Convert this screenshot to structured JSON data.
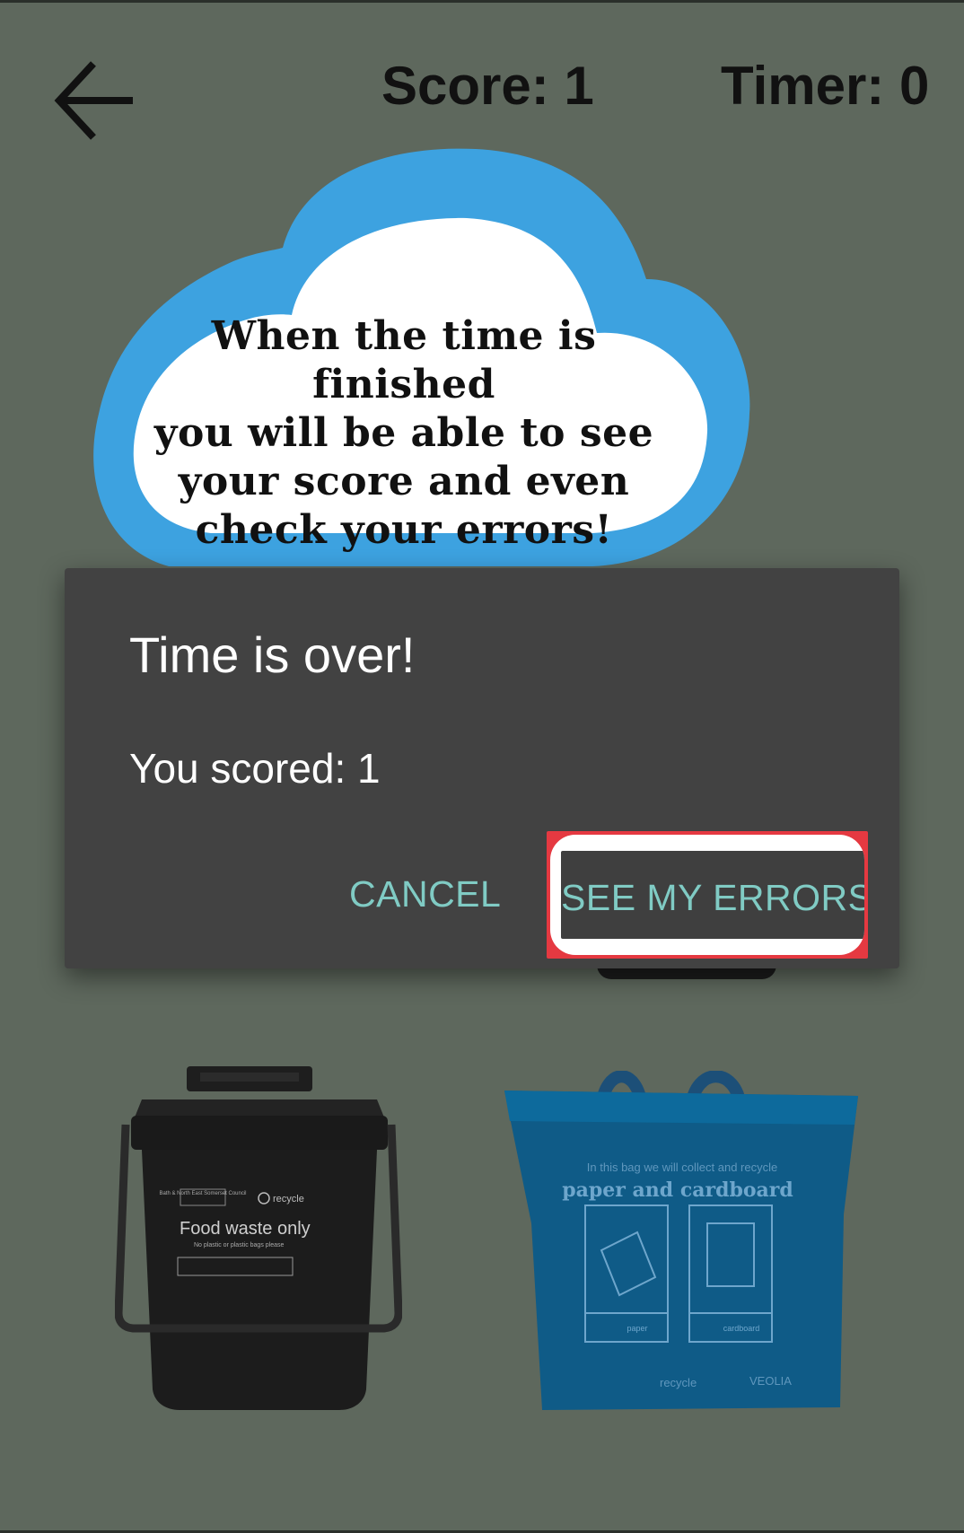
{
  "header": {
    "score_text": "Score: 1",
    "timer_text": "Timer: 0"
  },
  "tip_cloud": {
    "lines": [
      "When the time is finished",
      "you will be able to see",
      "your score and even",
      "check your errors!"
    ]
  },
  "dialog": {
    "title": "Time is over!",
    "message": "You scored: 1",
    "cancel_label": "CANCEL",
    "see_errors_label": "SEE MY ERRORS"
  },
  "food_bin": {
    "brand_text": "Bath & North East Somerset Council",
    "recycle_text": "recycle",
    "label": "Food waste only",
    "sublabel": "No plastic or plastic bags please"
  },
  "paper_bag": {
    "intro_text": "In this bag we will collect and recycle",
    "label": "paper and cardboard",
    "icon_1_label": "paper",
    "icon_2_label": "cardboard",
    "recycle_text": "recycle",
    "veolia_text": "VEOLIA"
  },
  "colors": {
    "background": "#5e685d",
    "dialog_bg": "#424242",
    "accent_teal": "#80cbc4",
    "highlight_red": "#e53941",
    "cloud_blue": "#3da2e0"
  }
}
